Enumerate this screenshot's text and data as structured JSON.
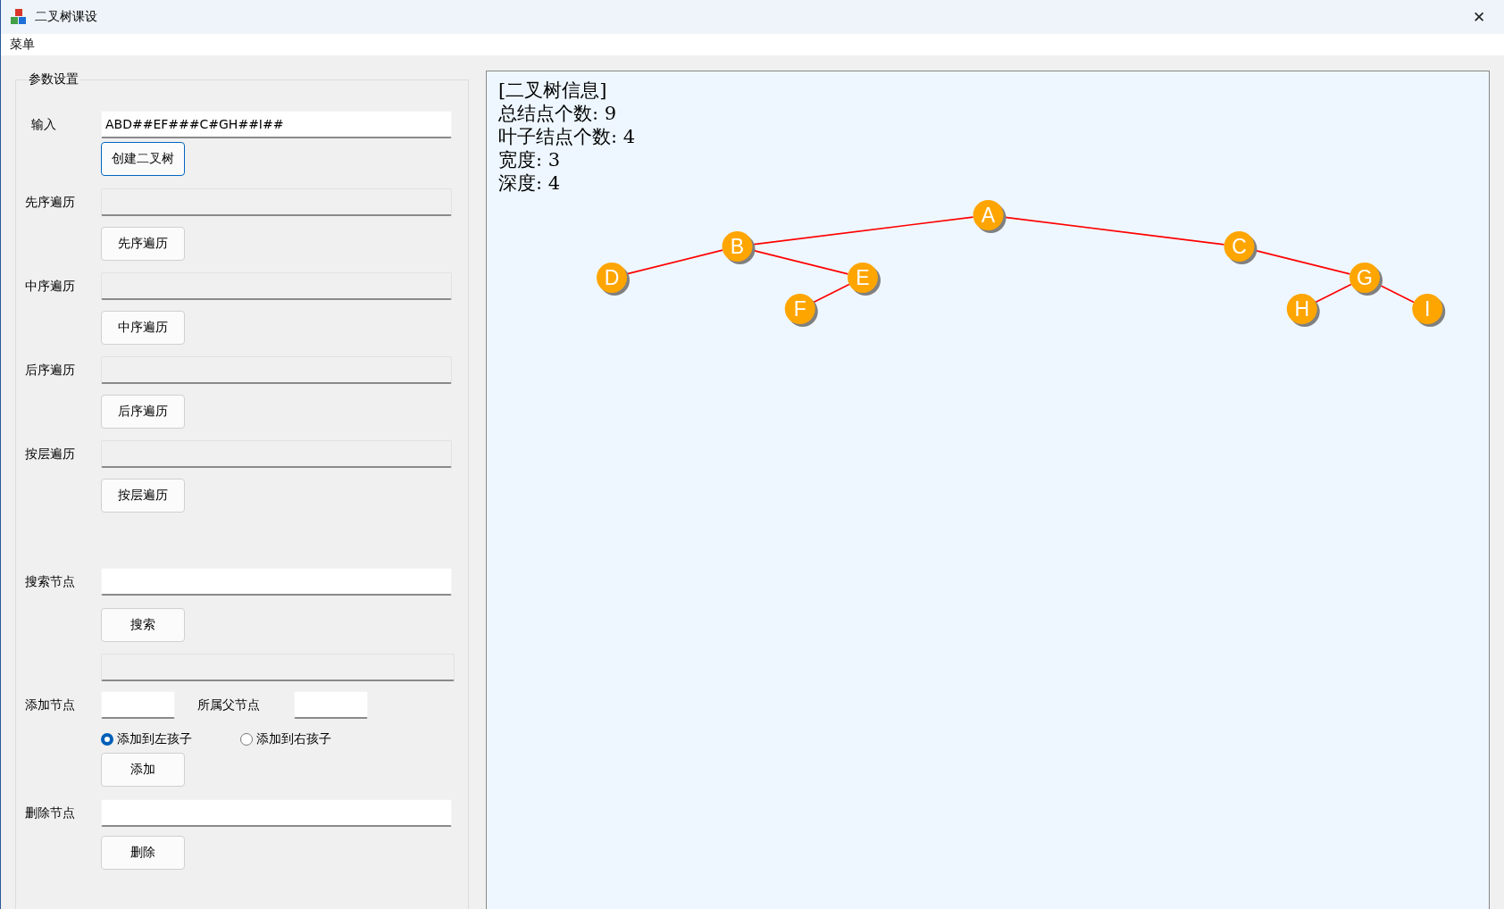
{
  "window": {
    "title": "二叉树课设",
    "close": "✕"
  },
  "menu": [
    "菜单"
  ],
  "params": {
    "title": "参数设置",
    "input": {
      "label": "输入",
      "value": "ABD##EF###C#GH##I##",
      "button": "创建二叉树"
    },
    "traversals": [
      {
        "label": "先序遍历",
        "button": "先序遍历"
      },
      {
        "label": "中序遍历",
        "button": "中序遍历"
      },
      {
        "label": "后序遍历",
        "button": "后序遍历"
      },
      {
        "label": "按层遍历",
        "button": "按层遍历"
      }
    ],
    "search": {
      "label": "搜索节点",
      "button": "搜索"
    },
    "add": {
      "label": "添加节点",
      "parent_label": "所属父节点",
      "options": [
        {
          "label": "添加到左孩子",
          "selected": true
        },
        {
          "label": "添加到右孩子",
          "selected": false
        }
      ],
      "button": "添加"
    },
    "delete": {
      "label": "删除节点",
      "button": "删除"
    }
  },
  "info": {
    "title": "[二叉树信息]",
    "lines": [
      "总结点个数: 9",
      "叶子结点个数: 4",
      "宽度: 3",
      "深度: 4"
    ]
  },
  "tree": {
    "label": "A",
    "children": [
      {
        "kind": "left",
        "label": "B",
        "children": [
          {
            "kind": "left",
            "label": "D"
          },
          {
            "kind": "right",
            "label": "E",
            "children": [
              {
                "kind": "left",
                "label": "F"
              }
            ]
          }
        ]
      },
      {
        "kind": "right",
        "label": "C",
        "children": [
          {
            "kind": "right",
            "label": "G",
            "children": [
              {
                "kind": "left",
                "label": "H"
              },
              {
                "kind": "right",
                "label": "I"
              }
            ]
          }
        ]
      }
    ]
  }
}
